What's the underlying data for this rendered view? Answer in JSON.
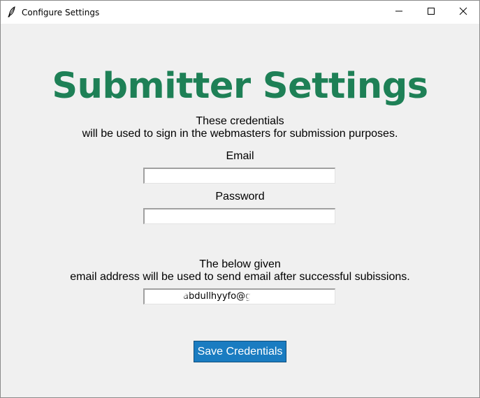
{
  "window": {
    "title": "Configure Settings",
    "icon": "feather-icon",
    "controls": [
      "minimize-icon",
      "maximize-icon",
      "close-icon"
    ]
  },
  "heading": "Submitter Settings",
  "description": {
    "line1": "These credentials",
    "line2": "will be used to sign in the webmasters for submission purposes."
  },
  "email": {
    "label": "Email",
    "value": ""
  },
  "password": {
    "label": "Password",
    "value": ""
  },
  "notify": {
    "line1": "The below given",
    "line2": "email address will be used to send email after successful subissions.",
    "value": "abdullhyyfo@g"
  },
  "save_button": {
    "label": "Save Credentials"
  },
  "colors": {
    "heading": "#1e8056",
    "button_bg": "#1a7cc1",
    "button_text": "#ffffff",
    "window_bg": "#f0f0f0"
  }
}
